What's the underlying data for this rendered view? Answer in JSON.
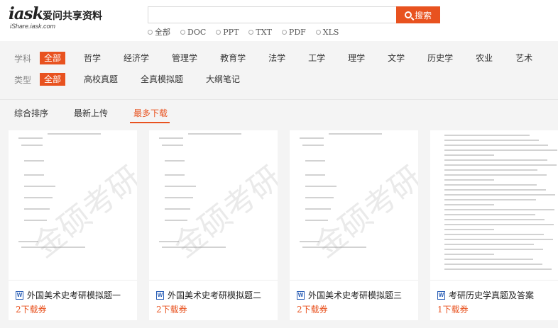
{
  "header": {
    "logo_mark": "iask",
    "logo_text": "爱问共享资料",
    "logo_sub": "iShare.iask.com",
    "search_placeholder": "",
    "search_button": "搜索",
    "filetypes": [
      "全部",
      "DOC",
      "PPT",
      "TXT",
      "PDF",
      "XLS"
    ]
  },
  "filters": {
    "subject": {
      "label": "学科",
      "items": [
        "全部",
        "哲学",
        "经济学",
        "管理学",
        "教育学",
        "法学",
        "工学",
        "理学",
        "文学",
        "历史学",
        "农业",
        "艺术"
      ],
      "active": "全部"
    },
    "type": {
      "label": "类型",
      "items": [
        "全部",
        "高校真题",
        "全真模拟题",
        "大纲笔记"
      ],
      "active": "全部"
    }
  },
  "sort": {
    "tabs": [
      "综合排序",
      "最新上传",
      "最多下载"
    ],
    "active": "最多下载"
  },
  "cards": [
    {
      "title": "外国美术史考研模拟题一",
      "meta": "2下载券",
      "watermark": "金硕考研",
      "file_icon": "W"
    },
    {
      "title": "外国美术史考研模拟题二",
      "meta": "2下载券",
      "watermark": "金硕考研",
      "file_icon": "W"
    },
    {
      "title": "外国美术史考研模拟题三",
      "meta": "2下载券",
      "watermark": "金硕考研",
      "file_icon": "W"
    },
    {
      "title": "考研历史学真题及答案",
      "meta": "1下载券",
      "watermark": "",
      "file_icon": "W"
    }
  ],
  "colors": {
    "accent": "#e8521f",
    "word_blue": "#2b5fb6"
  }
}
